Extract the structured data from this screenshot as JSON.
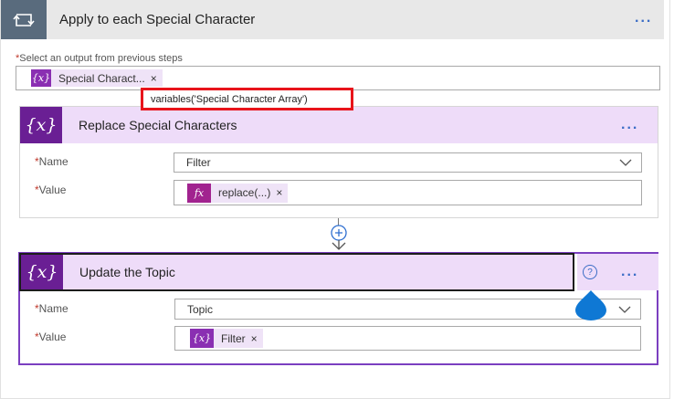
{
  "loop": {
    "title": "Apply to each Special Character",
    "menu": "...",
    "select_label": "Select an output from previous steps",
    "required_mark": "*",
    "token_icon": "{x}",
    "token_label": "Special Charact...",
    "token_remove": "×"
  },
  "tooltip": {
    "text": "variables('Special Character Array')"
  },
  "replace_card": {
    "icon_text": "{x}",
    "title": "Replace Special Characters",
    "menu": "...",
    "name_label": "Name",
    "name_value": "Filter",
    "value_label": "Value",
    "value_token_icon": "fx",
    "value_token_label": "replace(...)",
    "value_token_remove": "×"
  },
  "update_card": {
    "icon_text": "{x}",
    "title": "Update the Topic",
    "menu": "...",
    "help_icon": "?",
    "name_label": "Name",
    "name_value": "Topic",
    "value_label": "Value",
    "value_token_icon": "{x}",
    "value_token_label": "Filter",
    "value_token_remove": "×"
  },
  "colors": {
    "variable_purple": "#6a1f94",
    "header_lilac": "#eedcf9",
    "loop_gray": "#596b7d",
    "highlight_red": "#e8141b",
    "accent_blue": "#0f78d4"
  }
}
